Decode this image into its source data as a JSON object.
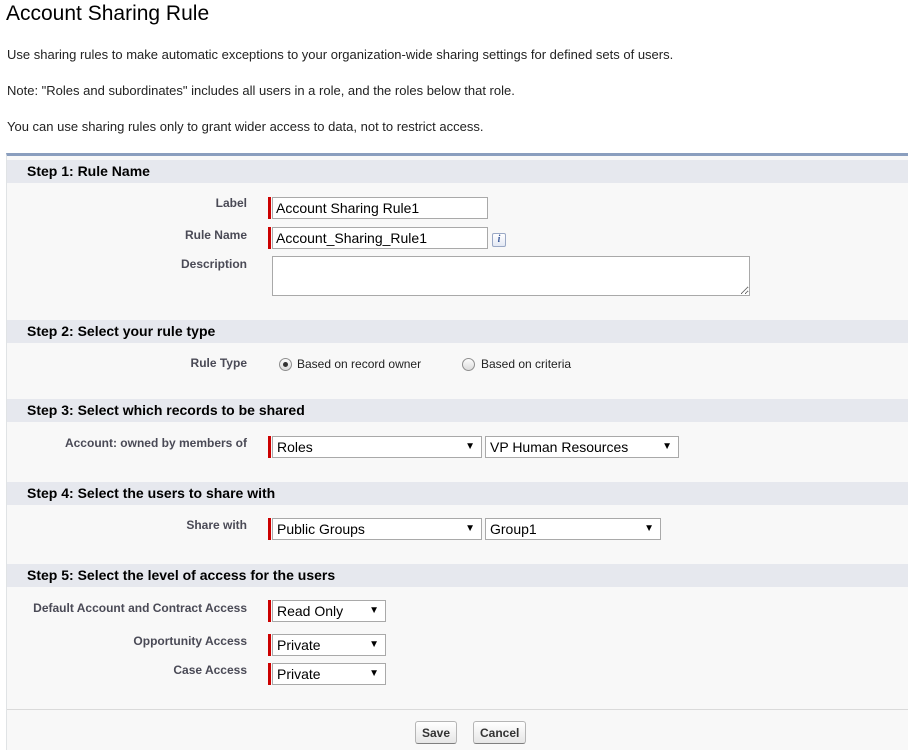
{
  "page": {
    "title": "Account Sharing Rule",
    "intro": [
      "Use sharing rules to make automatic exceptions to your organization-wide sharing settings for defined sets of users.",
      "Note: \"Roles and subordinates\" includes all users in a role, and the roles below that role.",
      "You can use sharing rules only to grant wider access to data, not to restrict access."
    ]
  },
  "step1": {
    "heading": "Step 1: Rule Name",
    "label_caption": "Label",
    "label_value": "Account Sharing Rule1",
    "rule_name_caption": "Rule Name",
    "rule_name_value": "Account_Sharing_Rule1",
    "description_caption": "Description",
    "description_value": "",
    "info_icon_glyph": "i"
  },
  "step2": {
    "heading": "Step 2: Select your rule type",
    "rule_type_caption": "Rule Type",
    "option_owner": "Based on record owner",
    "option_criteria": "Based on criteria",
    "selected": "owner"
  },
  "step3": {
    "heading": "Step 3: Select which records to be shared",
    "caption": "Account: owned by members of",
    "group_type": "Roles",
    "group_value": "VP Human Resources"
  },
  "step4": {
    "heading": "Step 4: Select the users to share with",
    "caption": "Share with",
    "group_type": "Public Groups",
    "group_value": "Group1"
  },
  "step5": {
    "heading": "Step 5: Select the level of access for the users",
    "account_caption": "Default Account and Contract Access",
    "account_value": "Read Only",
    "opportunity_caption": "Opportunity Access",
    "opportunity_value": "Private",
    "case_caption": "Case Access",
    "case_value": "Private"
  },
  "buttons": {
    "save": "Save",
    "cancel": "Cancel"
  },
  "icons": {
    "dropdown_arrow": "▼",
    "required_marker_color": "#cc0000"
  }
}
